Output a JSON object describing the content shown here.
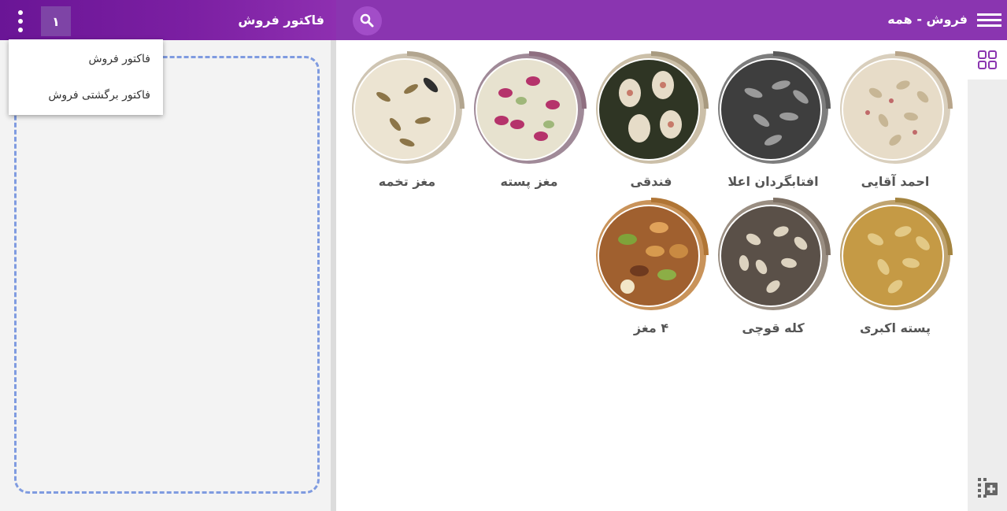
{
  "invoice": {
    "title": "فاکتور فروش",
    "number": "۱",
    "menu": {
      "items": [
        {
          "label": "فاکتور فروش"
        },
        {
          "label": "فاکتور برگشتی فروش"
        }
      ]
    }
  },
  "sales": {
    "title": "فروش - همه",
    "icons": {
      "menu": "hamburger-menu-icon",
      "search": "search-icon",
      "grid": "grid-view-icon",
      "add": "add-grid-icon"
    }
  },
  "colors": {
    "header_purple": "#8a35b0",
    "header_dark_purple": "#6a1596",
    "drop_zone_border": "#7f9be0"
  },
  "products": [
    {
      "name": "احمد آقایی",
      "image": "pistachio-image"
    },
    {
      "name": "افتابگردان اعلا",
      "image": "sunflower-seeds-image"
    },
    {
      "name": "فندقی",
      "image": "fandoghi-pistachio-image"
    },
    {
      "name": "مغز پسته",
      "image": "pistachio-kernel-image"
    },
    {
      "name": "مغز تخمه",
      "image": "seed-kernel-image"
    },
    {
      "name": "پسته اکبری",
      "image": "akbari-pistachio-image"
    },
    {
      "name": "کله قوچی",
      "image": "kalleh-ghouchi-pistachio-image"
    },
    {
      "name": "۴ مغز",
      "image": "mixed-nuts-image"
    }
  ]
}
